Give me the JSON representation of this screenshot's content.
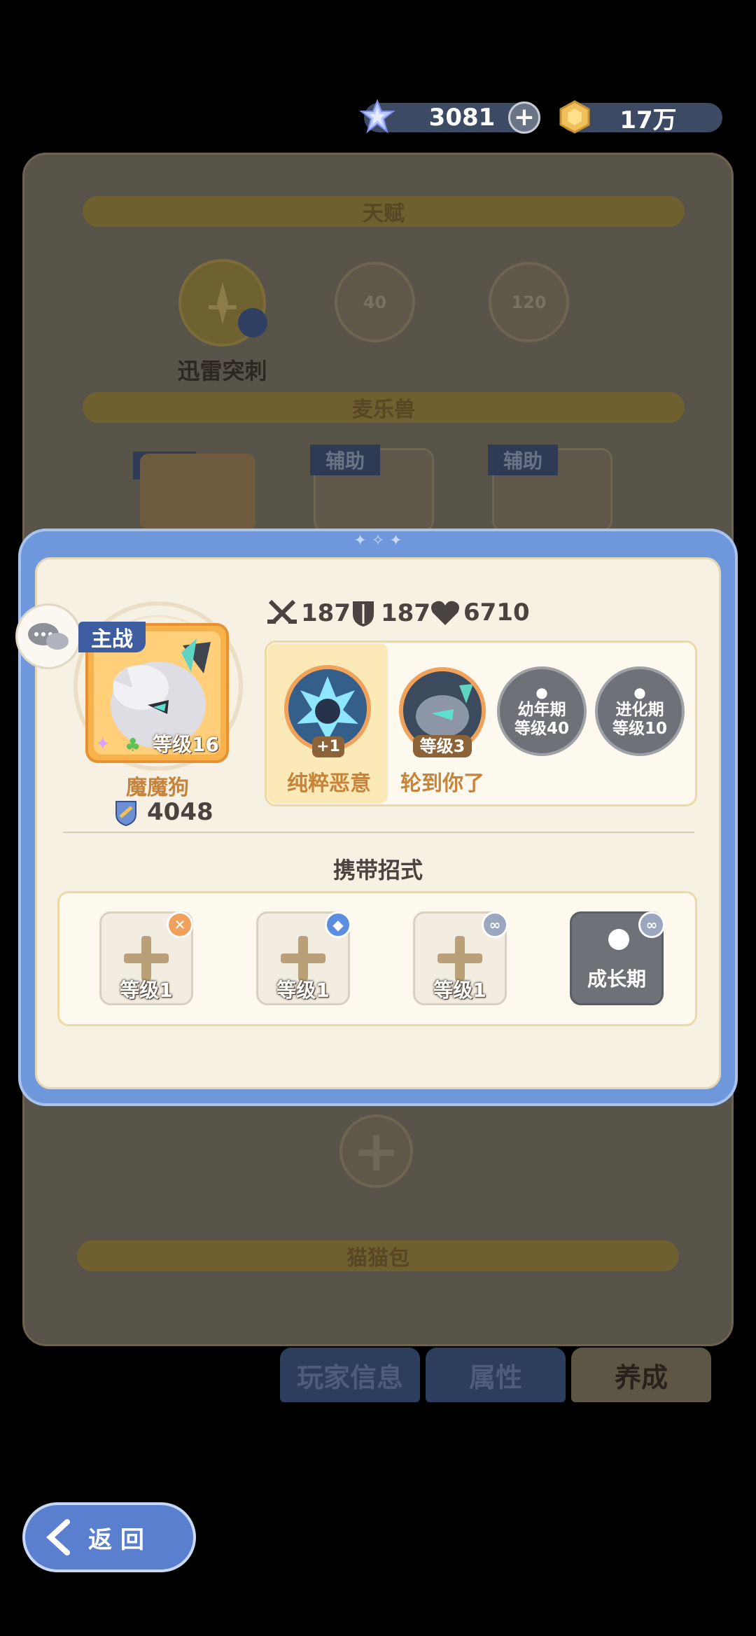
{
  "currency": {
    "gems": "3081",
    "coins": "17万",
    "add_button": "+"
  },
  "background": {
    "talent_header": "天赋",
    "talent_skill_name": "迅雷突刺",
    "talent_lock_1": "40",
    "talent_lock_2": "120",
    "pet_header": "麦乐兽",
    "slot_main": "主战",
    "slot_assist_1": "辅助",
    "slot_assist_2": "辅助",
    "bag_header": "猫猫包"
  },
  "tabs": [
    {
      "label": "玩家信息"
    },
    {
      "label": "属性"
    },
    {
      "label": "养成"
    }
  ],
  "modal": {
    "role_tag": "主战",
    "pet_name": "魔魔狗",
    "pet_level": "等级16",
    "pet_power": "4048",
    "stats": {
      "attack": "187",
      "defense": "187",
      "hp": "6710"
    },
    "skills": [
      {
        "name": "纯粹恶意",
        "badge": "+1"
      },
      {
        "name": "轮到你了",
        "badge": "等级3"
      }
    ],
    "locked_stages": [
      {
        "line1": "幼年期",
        "line2": "等级40"
      },
      {
        "line1": "进化期",
        "line2": "等级10"
      }
    ],
    "moves_title": "携带招式",
    "move_slots": [
      {
        "label": "等级1",
        "badge_icon": "sword-icon",
        "badge_color": "#f0a15c"
      },
      {
        "label": "等级1",
        "badge_icon": "shield-icon",
        "badge_color": "#5b8ee0"
      },
      {
        "label": "等级1",
        "badge_icon": "link-icon",
        "badge_color": "#9aa7bf"
      }
    ],
    "locked_move": "成长期"
  },
  "back_button": "返 回",
  "colors": {
    "modal_frame": "#6f98dc",
    "panel_cream": "#f7f1e4",
    "accent_orange": "#f0a15c",
    "text_brown": "#c7833a"
  }
}
